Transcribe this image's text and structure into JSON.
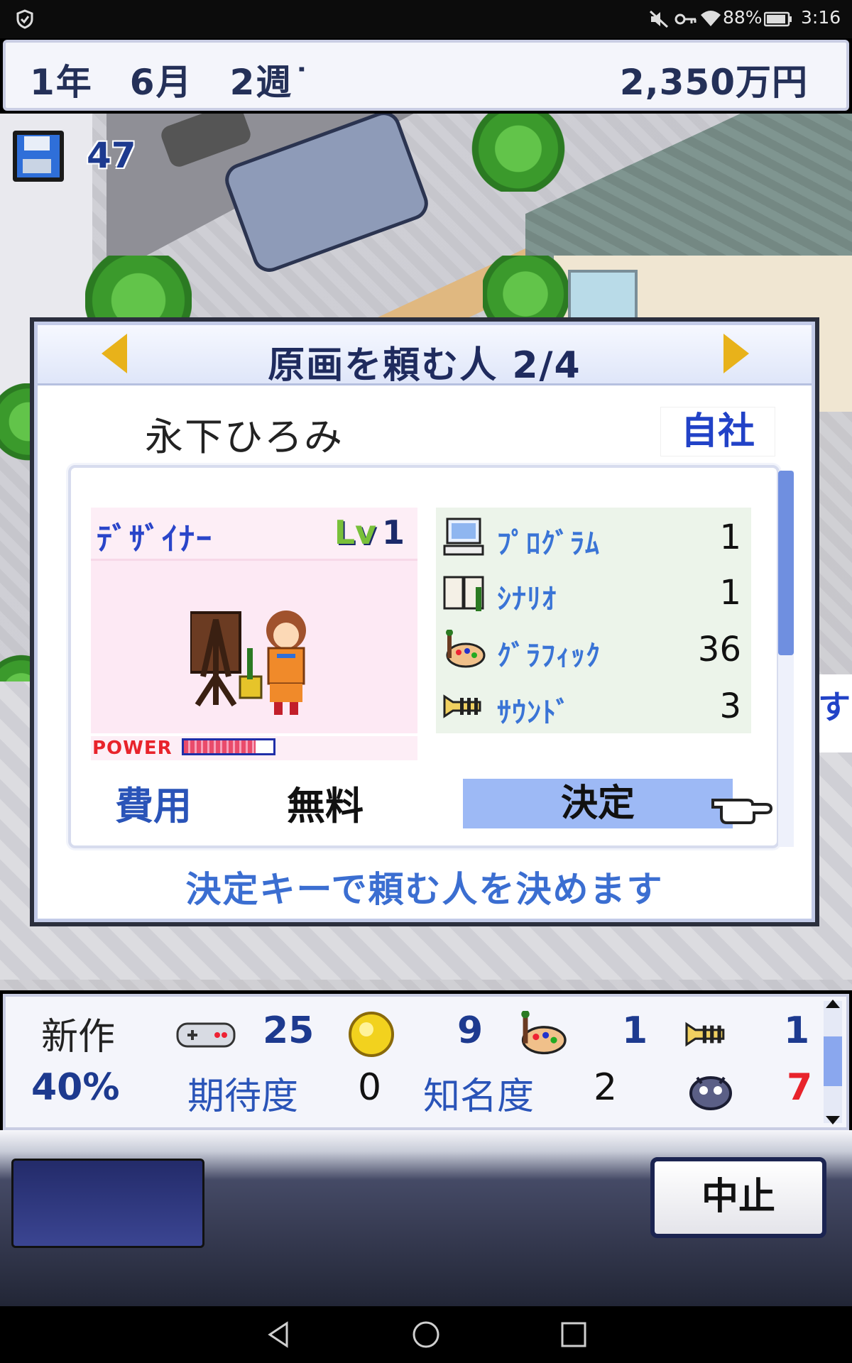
{
  "status_bar": {
    "battery": "88%",
    "time": "3:16"
  },
  "header": {
    "date": "1年　6月　2週˙",
    "money": "2,350万円"
  },
  "save": {
    "count": "47"
  },
  "dialog": {
    "title": "原画を頼む人 2/4",
    "name": "永下ひろみ",
    "affiliation": "自社",
    "job": "ﾃﾞｻﾞｲﾅｰ",
    "level_prefix": "Lv",
    "level": "1",
    "power_label": "POWER",
    "power_level": 0.8,
    "stats": [
      {
        "icon": "computer-icon",
        "label": "ﾌﾟﾛｸﾞﾗﾑ",
        "value": "1"
      },
      {
        "icon": "book-icon",
        "label": "ｼﾅﾘｵ",
        "value": "1"
      },
      {
        "icon": "palette-icon",
        "label": "ｸﾞﾗﾌｨｯｸ",
        "value": "36"
      },
      {
        "icon": "trumpet-icon",
        "label": "ｻｳﾝﾄﾞ",
        "value": "3"
      }
    ],
    "cost_label": "費用",
    "cost_value": "無料",
    "confirm": "決定",
    "hint": "決定キーで頼む人を決めます"
  },
  "info": {
    "new_label": "新作",
    "progress": "40%",
    "fun": "25",
    "creativity": "9",
    "graphics": "1",
    "sound": "1",
    "expectation_label": "期待度",
    "expectation": "0",
    "fame_label": "知名度",
    "fame": "2",
    "bugs": "7"
  },
  "menu": {
    "cancel": "中止"
  },
  "colors": {
    "accent": "#3b6ed1",
    "title": "#1f2b5e",
    "confirm_bg": "#9db9f5",
    "power_red": "#e8232b"
  }
}
